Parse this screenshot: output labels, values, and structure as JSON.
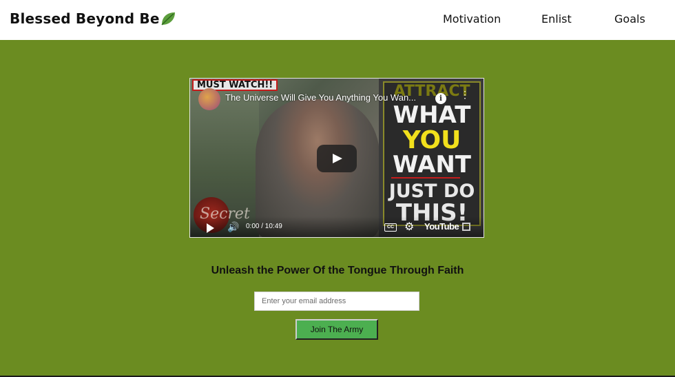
{
  "header": {
    "logo_text": "Blessed Beyond Be",
    "logo_icon": "leaf-icon",
    "nav": [
      {
        "label": "Motivation"
      },
      {
        "label": "Enlist"
      },
      {
        "label": "Goals"
      }
    ]
  },
  "video": {
    "badge": "MUST WATCH!!",
    "title": "The Universe Will Give You Anything You Wan...",
    "thumbnail_lines": [
      "ATTRACT",
      "WHAT",
      "YOU",
      "WANT",
      "JUST DO",
      "THIS!"
    ],
    "watermark": "Secret",
    "time": "0:00 / 10:49",
    "platform": "YouTube",
    "cc_label": "CC",
    "info_label": "i"
  },
  "signup": {
    "heading": "Unleash the Power Of the Tongue Through Faith",
    "email_placeholder": "Enter your email address",
    "email_value": "",
    "button_label": "Join The Army"
  },
  "colors": {
    "background": "#6b8c21",
    "header_bg": "#ffffff",
    "button_bg": "#4caf50",
    "accent_yellow": "#f2e01c"
  }
}
